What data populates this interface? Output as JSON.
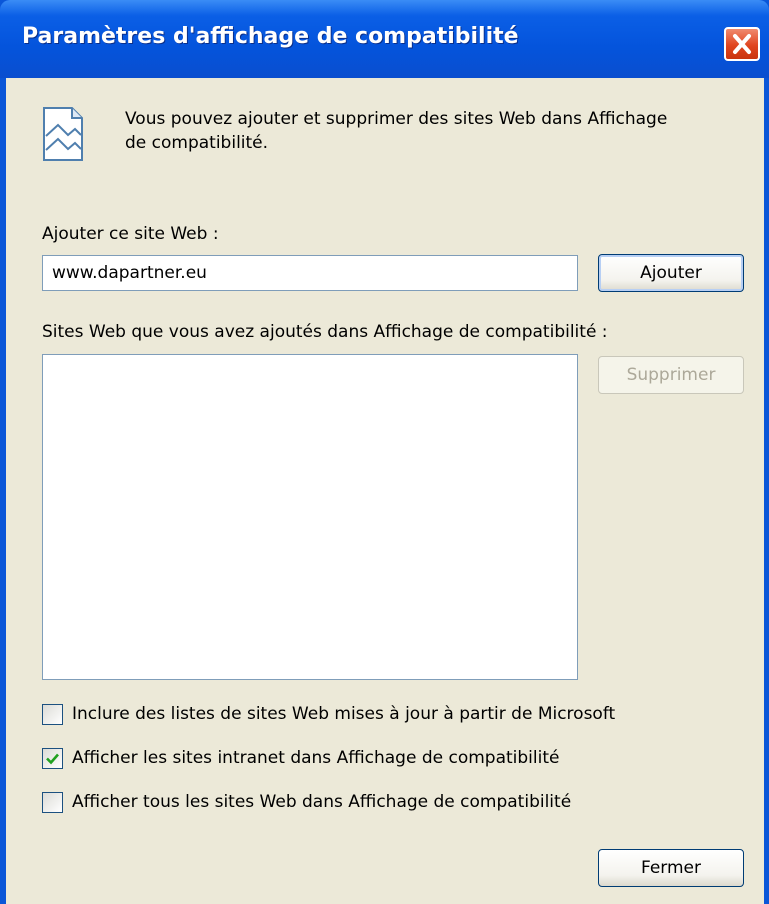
{
  "window": {
    "title": "Paramètres d'affichage de compatibilité",
    "close_icon": "close-icon"
  },
  "info": {
    "icon": "webpage-icon",
    "text": "Vous pouvez ajouter et supprimer des sites Web dans Affichage de compatibilité."
  },
  "add_site": {
    "label": "Ajouter ce site Web :",
    "value": "www.dapartner.eu",
    "button_label": "Ajouter"
  },
  "sites_list": {
    "label": "Sites Web que vous avez ajoutés dans Affichage de compatibilité :",
    "items": [],
    "remove_label": "Supprimer",
    "remove_enabled": false
  },
  "options": [
    {
      "label": "Inclure des listes de sites Web mises à jour à partir de Microsoft",
      "checked": false
    },
    {
      "label": "Afficher les sites intranet dans Affichage de compatibilité",
      "checked": true
    },
    {
      "label": "Afficher tous les sites Web dans Affichage de compatibilité",
      "checked": false
    }
  ],
  "close_label": "Fermer",
  "colors": {
    "titlebar": "#0454dc",
    "dialog_bg": "#ece9d8",
    "close_button": "#e0451f",
    "check_mark": "#21a121"
  }
}
